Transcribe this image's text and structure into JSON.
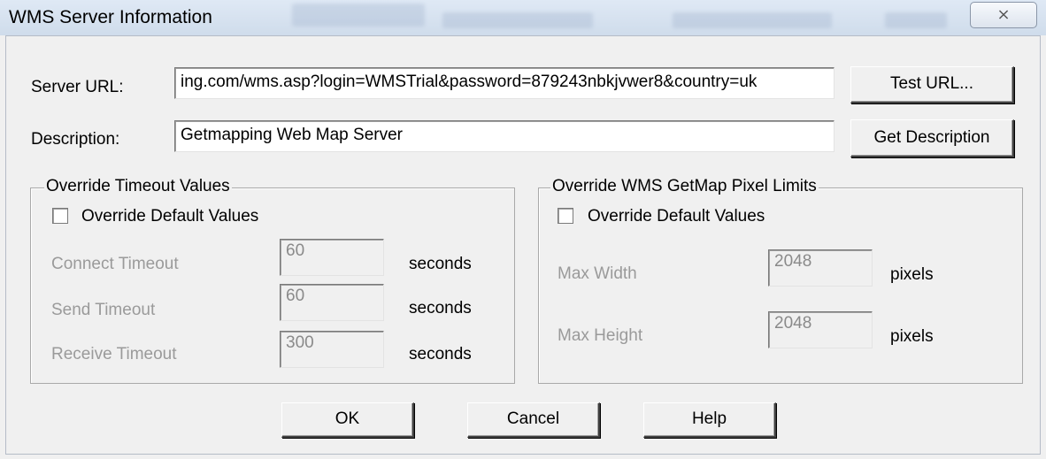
{
  "window": {
    "title": "WMS Server Information",
    "close_glyph": "⨯"
  },
  "server": {
    "url_label": "Server URL:",
    "url_value": "ing.com/wms.asp?login=WMSTrial&password=879243nbkjvwer8&country=uk",
    "test_url_button": "Test URL...",
    "description_label": "Description:",
    "description_value": "Getmapping Web Map Server",
    "get_description_button": "Get Description"
  },
  "timeout_group": {
    "legend": "Override Timeout Values",
    "override_checkbox_label": "Override Default Values",
    "override_checked": false,
    "rows": [
      {
        "label": "Connect Timeout",
        "value": "60",
        "unit": "seconds"
      },
      {
        "label": "Send Timeout",
        "value": "60",
        "unit": "seconds"
      },
      {
        "label": "Receive Timeout",
        "value": "300",
        "unit": "seconds"
      }
    ]
  },
  "pixel_group": {
    "legend": "Override WMS GetMap Pixel Limits",
    "override_checkbox_label": "Override Default Values",
    "override_checked": false,
    "rows": [
      {
        "label": "Max Width",
        "value": "2048",
        "unit": "pixels"
      },
      {
        "label": "Max Height",
        "value": "2048",
        "unit": "pixels"
      }
    ]
  },
  "buttons": {
    "ok": "OK",
    "cancel": "Cancel",
    "help": "Help"
  }
}
